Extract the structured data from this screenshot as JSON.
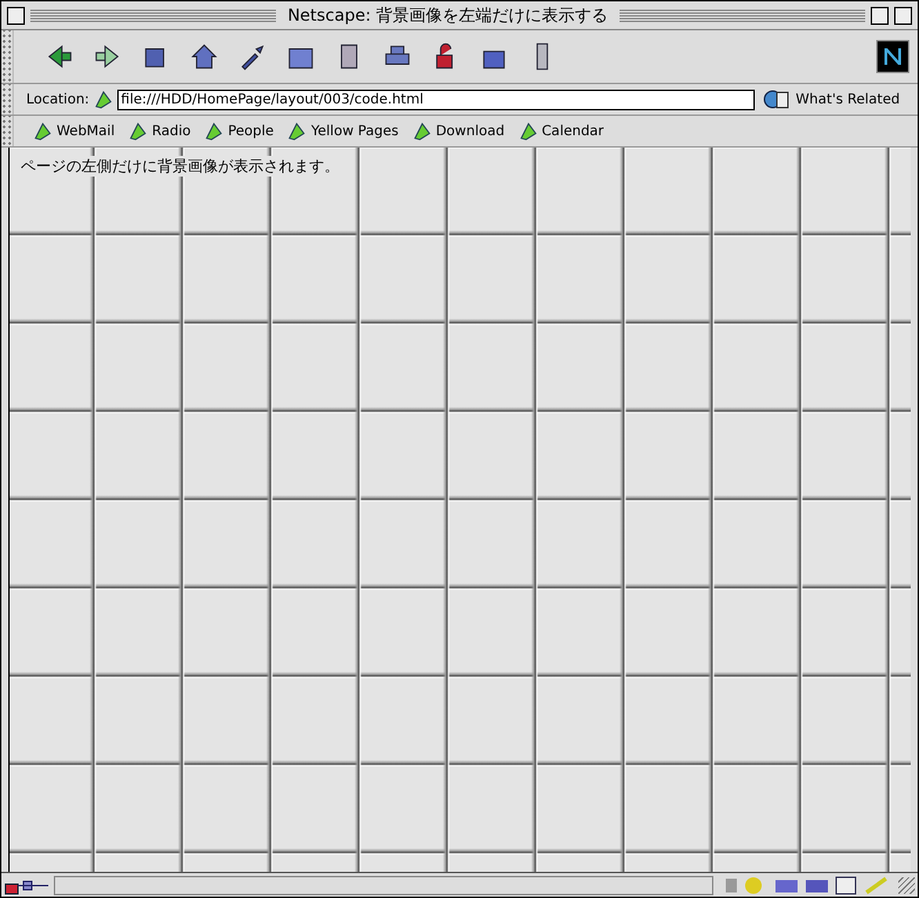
{
  "window": {
    "title": "Netscape: 背景画像を左端だけに表示する"
  },
  "location": {
    "label": "Location:",
    "value": "file:///HDD/HomePage/layout/003/code.html"
  },
  "whats_related": "What's Related",
  "personal_toolbar": [
    "WebMail",
    "Radio",
    "People",
    "Yellow Pages",
    "Download",
    "Calendar"
  ],
  "content": {
    "text": "ページの左側だけに背景画像が表示されます。"
  }
}
